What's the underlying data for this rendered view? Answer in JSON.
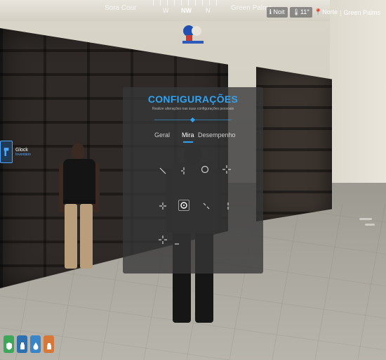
{
  "compass": {
    "street_left": "Sora Cour",
    "street_right": "Green Palms",
    "directions": [
      "W",
      "NW",
      "N"
    ],
    "active_direction": "NW"
  },
  "location": {
    "time_chip": "Noit",
    "temp_chip": "11°",
    "direction": "Norte",
    "zone": "Green Palms"
  },
  "weapon": {
    "name": "Glock",
    "subtitle": "Inventário"
  },
  "settings": {
    "title": "CONFIGURAÇÕES",
    "subtitle": "Realize alterações nas suas configurações pessoais",
    "tabs": [
      "Geral",
      "Mira",
      "Desempenho"
    ],
    "active_tab": "Mira",
    "crosshairs": [
      "crosshair-1",
      "crosshair-2",
      "crosshair-3",
      "crosshair-4",
      "crosshair-5",
      "crosshair-6",
      "crosshair-7",
      "crosshair-8",
      "crosshair-9",
      "crosshair-10"
    ],
    "selected_crosshair": "crosshair-6"
  },
  "status_icons": [
    {
      "name": "health-icon",
      "color": "#3ea85a"
    },
    {
      "name": "hunger-icon",
      "color": "#2e6fae"
    },
    {
      "name": "thirst-icon",
      "color": "#3a85c8"
    },
    {
      "name": "stamina-icon",
      "color": "#d6783a"
    }
  ],
  "colors": {
    "accent": "#2fa3f2",
    "panel_bg": "#37373a"
  }
}
